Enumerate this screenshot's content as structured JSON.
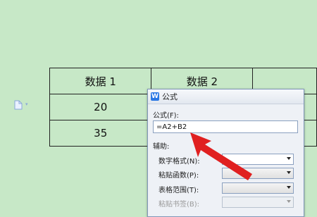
{
  "table": {
    "rows": [
      [
        "数据 1",
        "数据 2",
        ""
      ],
      [
        "20",
        "",
        ""
      ],
      [
        "35",
        "",
        ""
      ]
    ]
  },
  "dialog": {
    "app_icon": "W",
    "title": "公式",
    "formula_label": "公式(F):",
    "formula_value": "=A2+B2",
    "assist_label": "辅助:",
    "number_format_label": "数字格式(N):",
    "paste_function_label": "粘贴函数(P):",
    "table_range_label": "表格范围(T):",
    "paste_bookmark_label": "粘贴书签(B):"
  },
  "colors": {
    "background": "#c7e8c7",
    "arrow": "#e02020"
  }
}
